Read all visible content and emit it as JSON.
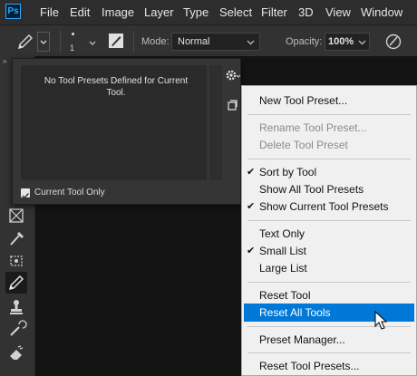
{
  "menubar": {
    "logo": "Ps",
    "items": [
      "File",
      "Edit",
      "Image",
      "Layer",
      "Type",
      "Select",
      "Filter",
      "3D",
      "View",
      "Window"
    ]
  },
  "options": {
    "brush_size": "1",
    "mode_label": "Mode:",
    "mode_value": "Normal",
    "opacity_label": "Opacity:",
    "opacity_value": "100%"
  },
  "preset_panel": {
    "empty_message": "No Tool Presets Defined for Current Tool.",
    "current_tool_only_label": "Current Tool Only",
    "current_tool_only_checked": true
  },
  "context_menu": {
    "items": [
      {
        "label": "New Tool Preset...",
        "enabled": true,
        "checked": false
      },
      {
        "label": "Rename Tool Preset...",
        "enabled": false,
        "checked": false
      },
      {
        "label": "Delete Tool Preset",
        "enabled": false,
        "checked": false
      },
      {
        "label": "Sort by Tool",
        "enabled": true,
        "checked": true
      },
      {
        "label": "Show All Tool Presets",
        "enabled": true,
        "checked": false
      },
      {
        "label": "Show Current Tool Presets",
        "enabled": true,
        "checked": true
      },
      {
        "label": "Text Only",
        "enabled": true,
        "checked": false
      },
      {
        "label": "Small List",
        "enabled": true,
        "checked": true
      },
      {
        "label": "Large List",
        "enabled": true,
        "checked": false
      },
      {
        "label": "Reset Tool",
        "enabled": true,
        "checked": false
      },
      {
        "label": "Reset All Tools",
        "enabled": true,
        "checked": false,
        "highlighted": true
      },
      {
        "label": "Preset Manager...",
        "enabled": true,
        "checked": false
      },
      {
        "label": "Reset Tool Presets...",
        "enabled": true,
        "checked": false
      }
    ]
  },
  "colors": {
    "highlight": "#0078d7",
    "menu_bg": "#f0f0f0",
    "ui_dark": "#323232"
  }
}
